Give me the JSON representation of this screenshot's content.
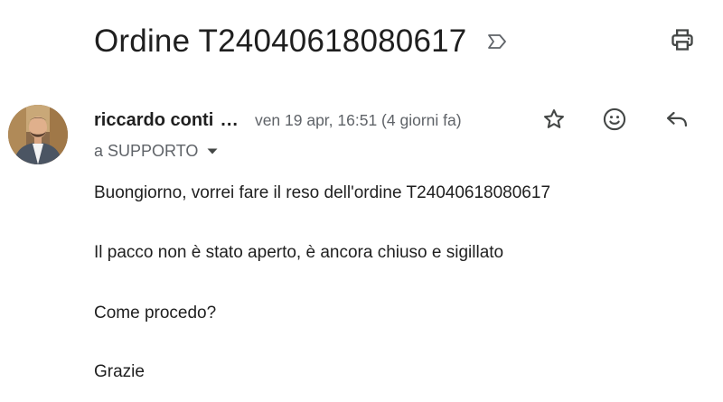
{
  "email": {
    "subject": "Ordine T24040618080617",
    "sender": {
      "name": "riccardo conti",
      "ellipsis": "...",
      "date": "ven 19 apr, 16:51 (4 giorni fa)"
    },
    "recipient": "a SUPPORTO",
    "body": [
      "Buongiorno, vorrei fare il reso dell'ordine T24040618080617",
      "Il pacco non è stato aperto, è ancora chiuso e sigillato",
      "Come procedo?",
      "Grazie"
    ]
  },
  "icons": {
    "label": "label-outline-icon",
    "print": "print-icon",
    "star": "star-outline-icon",
    "emoji": "emoji-reaction-icon",
    "reply": "reply-icon",
    "recipient_dropdown": "caret-down-icon"
  },
  "colors": {
    "text_primary": "#1f1f1f",
    "text_secondary": "#5f6368",
    "icon": "#444746"
  }
}
